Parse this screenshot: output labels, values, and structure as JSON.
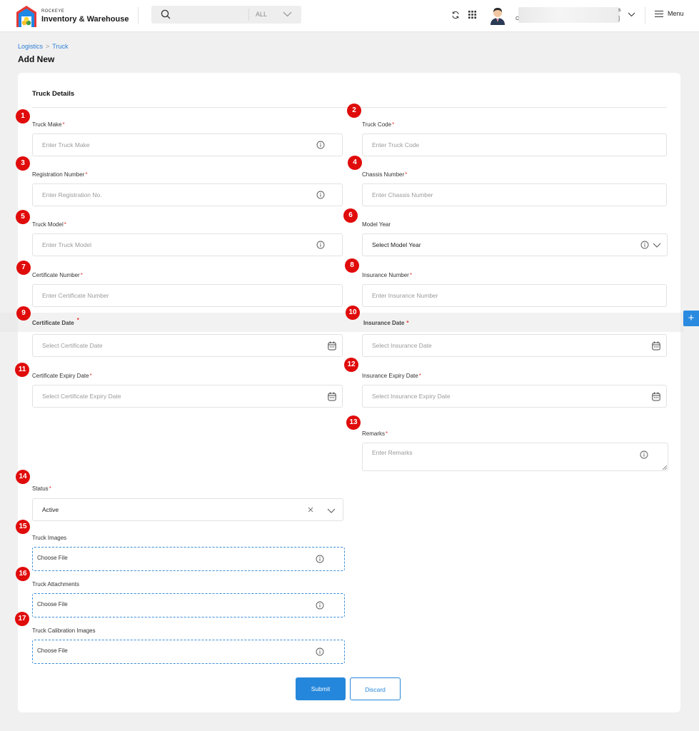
{
  "header": {
    "brand_small": "ROCKEYE",
    "brand_name": "Inventory & Warehouse",
    "search_scope": "ALL",
    "user_line1_tail": "s",
    "user_line2_head": "C",
    "user_line2_tail": "]",
    "menu_label": "Menu"
  },
  "breadcrumb": {
    "items": [
      "Logistics",
      "Truck"
    ],
    "separator": ">"
  },
  "page_title": "Add New",
  "section_title": "Truck Details",
  "fields": {
    "truck_make": {
      "label": "Truck Make",
      "placeholder": "Enter Truck Make"
    },
    "truck_code": {
      "label": "Truck Code",
      "placeholder": "Enter Truck Code"
    },
    "registration_number": {
      "label": "Registration Number",
      "placeholder": "Enter Registration No."
    },
    "chassis_number": {
      "label": "Chassis Number",
      "placeholder": "Enter Chassis Number"
    },
    "truck_model": {
      "label": "Truck Model",
      "placeholder": "Enter Truck Model"
    },
    "model_year": {
      "label": "Model Year",
      "value": "Select Model Year"
    },
    "certificate_number": {
      "label": "Certificate Number",
      "placeholder": "Enter Certificate Number"
    },
    "insurance_number": {
      "label": "Insurance Number",
      "placeholder": "Enter Insurance Number"
    },
    "certificate_date": {
      "label": "Certificate Date",
      "placeholder": "Select Certificate Date"
    },
    "insurance_date": {
      "label": "Insurance Date",
      "placeholder": "Select Insurance Date"
    },
    "certificate_expiry_date": {
      "label": "Certificate Expiry Date",
      "placeholder": "Select Certificate Expiry Date"
    },
    "insurance_expiry_date": {
      "label": "Insurance Expiry Date",
      "placeholder": "Select Insurance Expiry Date"
    },
    "remarks": {
      "label": "Remarks",
      "placeholder": "Enter Remarks"
    },
    "status": {
      "label": "Status",
      "value": "Active"
    },
    "truck_images": {
      "label": "Truck Images",
      "placeholder": "Choose File"
    },
    "truck_attachments": {
      "label": "Truck Attachments",
      "placeholder": "Choose File"
    },
    "truck_calibration_images": {
      "label": "Truck Calibration Images",
      "placeholder": "Choose File"
    }
  },
  "required_mark": "*",
  "badges": [
    "1",
    "2",
    "3",
    "4",
    "5",
    "6",
    "7",
    "8",
    "9",
    "10",
    "11",
    "12",
    "13",
    "14",
    "15",
    "16",
    "17"
  ],
  "buttons": {
    "submit": "Submit",
    "discard": "Discard",
    "add": "+"
  },
  "colors": {
    "accent": "#2587db",
    "badge": "#e00b0b",
    "required": "#e53935"
  }
}
